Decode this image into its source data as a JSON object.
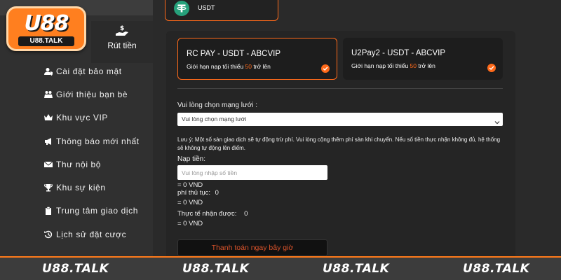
{
  "logo": {
    "main": "U88",
    "sub": "U88.TALK"
  },
  "sidebar": {
    "withdraw": {
      "label": "Rút tiền",
      "icon": "hand-money-icon"
    },
    "items": [
      {
        "label": "Cài đặt bảo mật",
        "icon": "user-shield-icon"
      },
      {
        "label": "Giới thiệu bạn bè",
        "icon": "users-icon"
      },
      {
        "label": "Khu vực VIP",
        "icon": "crown-icon"
      },
      {
        "label": "Thông báo mới nhất",
        "icon": "megaphone-icon"
      },
      {
        "label": "Thư nội bộ",
        "icon": "envelope-icon"
      },
      {
        "label": "Khu sự kiện",
        "icon": "trophy-icon"
      },
      {
        "label": "Trung tâm giao dịch",
        "icon": "clipboard-icon"
      },
      {
        "label": "Lịch sử đặt cược",
        "icon": "history-icon"
      }
    ]
  },
  "top_card": {
    "label": "USDT",
    "icon": "tether-icon"
  },
  "payment_options": [
    {
      "title": "RC PAY - USDT - ABCVIP",
      "limit_prefix": "Giới hạn nạp tối thiểu ",
      "limit_amount": "50",
      "limit_suffix": " trở lên",
      "selected": true
    },
    {
      "title": "U2Pay2 - USDT - ABCVIP",
      "limit_prefix": "Giới hạn nạp tối thiểu ",
      "limit_amount": "50",
      "limit_suffix": " trở lên",
      "selected": false
    }
  ],
  "network": {
    "label": "Vui lòng chọn mạng lưới :",
    "selected": "Vui lòng chọn mạng lưới"
  },
  "note": "Lưu ý: Một số sàn giao dịch sẽ tự động trừ phí. Vui lòng cộng thêm phí sàn khi chuyển. Nếu số tiền thực nhận không đủ, hệ thống sẽ không tự động lên điểm.",
  "amount": {
    "label": "Nạp tiền:",
    "placeholder": "Vui lòng nhập số tiền",
    "vnd_value": "= 0 VND",
    "fee_label": "phí thủ tục:",
    "fee_value": "0",
    "fee_vnd": "= 0 VND",
    "actual_label": "Thực tế nhận được:",
    "actual_value": "0",
    "actual_vnd": "= 0 VND"
  },
  "pay_button": "Thanh toán ngay bây giờ",
  "watermarks": [
    "U88.TALK",
    "U88.TALK",
    "U88.TALK",
    "U88.TALK"
  ],
  "colors": {
    "accent": "#ff6a1a",
    "background": "#2a2a2a",
    "panel": "#252525",
    "sidebar": "#303030"
  }
}
